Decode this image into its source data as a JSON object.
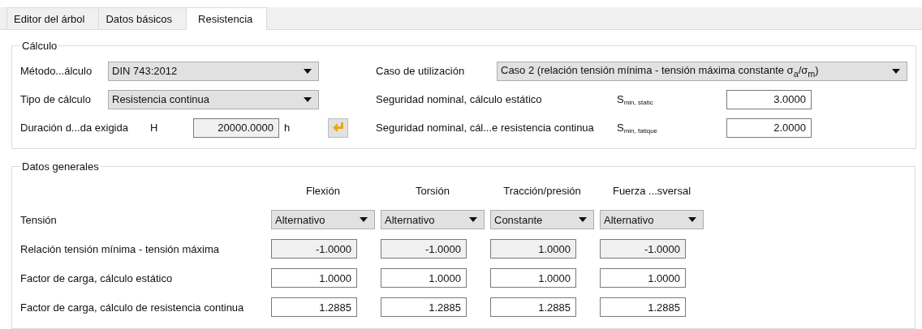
{
  "tabs": [
    {
      "label": "Editor del árbol",
      "selected": false
    },
    {
      "label": "Datos básicos",
      "selected": false
    },
    {
      "label": "Resistencia",
      "selected": true
    }
  ],
  "calculation": {
    "title": "Cálculo",
    "left": [
      {
        "kind": "combo",
        "label": "Método...álculo",
        "value": "DIN 743:2012"
      },
      {
        "kind": "combo",
        "label": "Tipo de cálculo",
        "value": "Resistencia continua"
      },
      {
        "kind": "number",
        "label": "Duración d...da exigida",
        "symbol": "H",
        "value": "20000.0000",
        "readonly": true,
        "unit": "h"
      }
    ],
    "right": [
      {
        "kind": "combo",
        "label": "Caso de utilización",
        "value": "Caso 2 (relación tensión mínima - tensión máxima constante σ$_{a}$/σ$_{m}$)"
      },
      {
        "kind": "number",
        "label": "Seguridad nominal, cálculo estático",
        "symbol": "S$_{min, static}$",
        "value": "3.0000",
        "readonly": false
      },
      {
        "kind": "number",
        "label": "Seguridad nominal, cál...e resistencia continua",
        "symbol": "S$_{min, fatique}$",
        "value": "2.0000",
        "readonly": false
      }
    ]
  },
  "general": {
    "title": "Datos generales",
    "columns": [
      "Flexión",
      "Torsión",
      "Tracción/presión",
      "Fuerza ...sversal"
    ],
    "rows": [
      {
        "kind": "combo",
        "label": "Tensión",
        "cells": [
          {
            "value": "Alternativo"
          },
          {
            "value": "Alternativo"
          },
          {
            "value": "Constante"
          },
          {
            "value": "Alternativo"
          }
        ]
      },
      {
        "kind": "number",
        "label": "Relación tensión mínima - tensión máxima",
        "cells": [
          {
            "value": "-1.0000",
            "readonly": true
          },
          {
            "value": "-1.0000",
            "readonly": true
          },
          {
            "value": "1.0000",
            "readonly": true
          },
          {
            "value": "-1.0000",
            "readonly": true
          }
        ]
      },
      {
        "kind": "number",
        "label": "Factor de carga, cálculo estático",
        "cells": [
          {
            "value": "1.0000",
            "readonly": false
          },
          {
            "value": "1.0000",
            "readonly": false
          },
          {
            "value": "1.0000",
            "readonly": false
          },
          {
            "value": "1.0000",
            "readonly": false
          }
        ]
      },
      {
        "kind": "number",
        "label": "Factor de carga, cálculo de resistencia continua",
        "cells": [
          {
            "value": "1.2885",
            "readonly": false
          },
          {
            "value": "1.2885",
            "readonly": false
          },
          {
            "value": "1.2885",
            "readonly": false
          },
          {
            "value": "1.2885",
            "readonly": false
          }
        ]
      }
    ]
  }
}
